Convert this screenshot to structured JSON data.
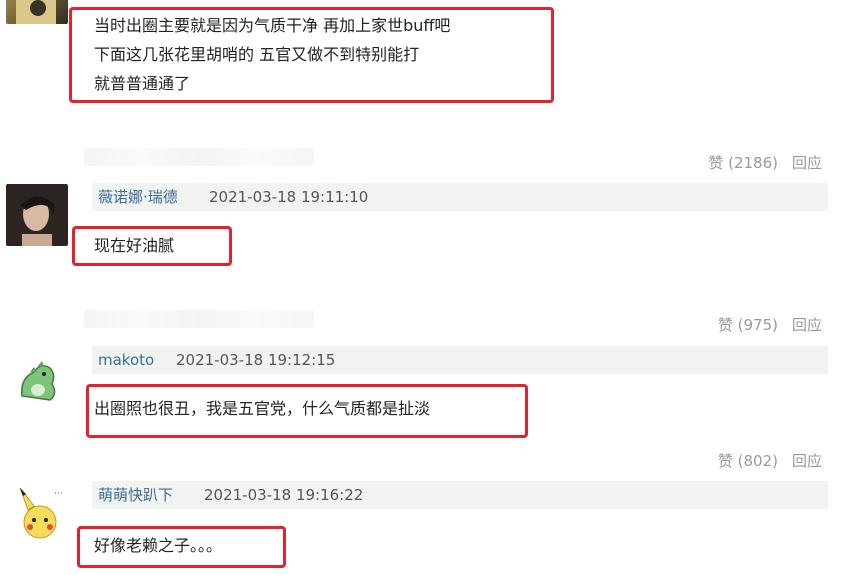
{
  "comments": [
    {
      "user": "",
      "time": "",
      "lines": [
        "当时出圈主要就是因为气质干净 再加上家世buff吧",
        "下面这几张花里胡哨的 五官又做不到特别能打",
        "就普普通通了"
      ]
    },
    {
      "user": "薇诺娜·瑞德",
      "time": "2021-03-18 19:11:10",
      "likes": "赞 (2186)",
      "reply": "回应",
      "lines": [
        "现在好油腻"
      ]
    },
    {
      "user": "makoto",
      "time": "2021-03-18 19:12:15",
      "likes": "赞 (975)",
      "reply": "回应",
      "lines": [
        "出圈照也很丑，我是五官党，什么气质都是扯淡"
      ]
    },
    {
      "user": "萌萌快趴下",
      "time": "2021-03-18 19:16:22",
      "likes": "赞 (802)",
      "reply": "回应",
      "lines": [
        "好像老赖之子。。。"
      ]
    }
  ]
}
